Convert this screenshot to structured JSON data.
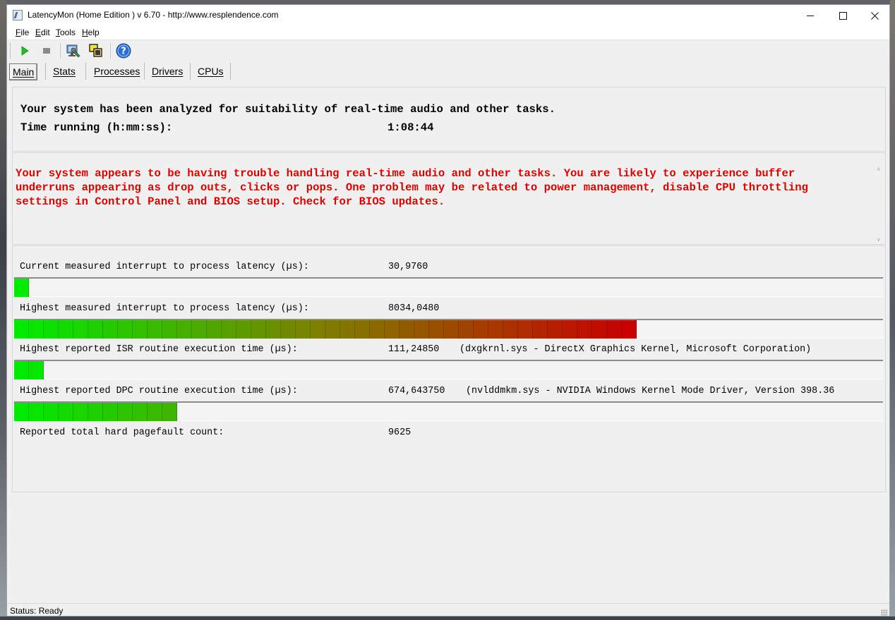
{
  "window": {
    "title": "LatencyMon  (Home Edition )  v 6.70 - http://www.resplendence.com",
    "controls": {
      "minimize": "minimize",
      "maximize": "maximize",
      "close": "close"
    }
  },
  "menu": {
    "items": [
      {
        "key": "F",
        "rest": "ile"
      },
      {
        "key": "E",
        "rest": "dit"
      },
      {
        "key": "T",
        "rest": "ools"
      },
      {
        "key": "H",
        "rest": "elp"
      }
    ]
  },
  "toolbar": {
    "icons": [
      "play-icon",
      "stop-icon",
      "wrench-monitor-icon",
      "windows-icon",
      "help-icon"
    ]
  },
  "tabs": [
    "Main",
    "Stats",
    "Processes",
    "Drivers",
    "CPUs"
  ],
  "summary": {
    "line1": "Your system has been analyzed for suitability of real-time audio and other tasks.",
    "time_label": "Time running (h:mm:ss):",
    "time_value": "1:08:44"
  },
  "warning": {
    "text": "Your system appears to be having trouble handling real-time audio and other tasks. You are likely to experience buffer\nunderruns appearing as drop outs, clicks or pops. One problem may be related to power management, disable CPU throttling\nsettings in Control Panel and BIOS setup. Check for BIOS updates.",
    "color": "#e00000"
  },
  "metrics": [
    {
      "label": "Current measured interrupt to process latency (µs):",
      "value": "30,9760",
      "extra": "",
      "segments": 1
    },
    {
      "label": "Highest measured interrupt to process latency (µs):",
      "value": "8034,0480",
      "extra": "",
      "segments": 42
    },
    {
      "label": "Highest reported ISR routine execution time (µs):",
      "value": "111,24850",
      "extra": "(dxgkrnl.sys - DirectX Graphics Kernel, Microsoft Corporation)",
      "segments": 2
    },
    {
      "label": "Highest reported DPC routine execution time (µs):",
      "value": "674,643750",
      "extra": "(nvlddmkm.sys - NVIDIA Windows Kernel Mode Driver, Version 398.36",
      "segments": 11
    },
    {
      "label": "Reported total hard pagefault count:",
      "value": "9625",
      "extra": ""
    }
  ],
  "status": {
    "text": "Status: Ready"
  }
}
